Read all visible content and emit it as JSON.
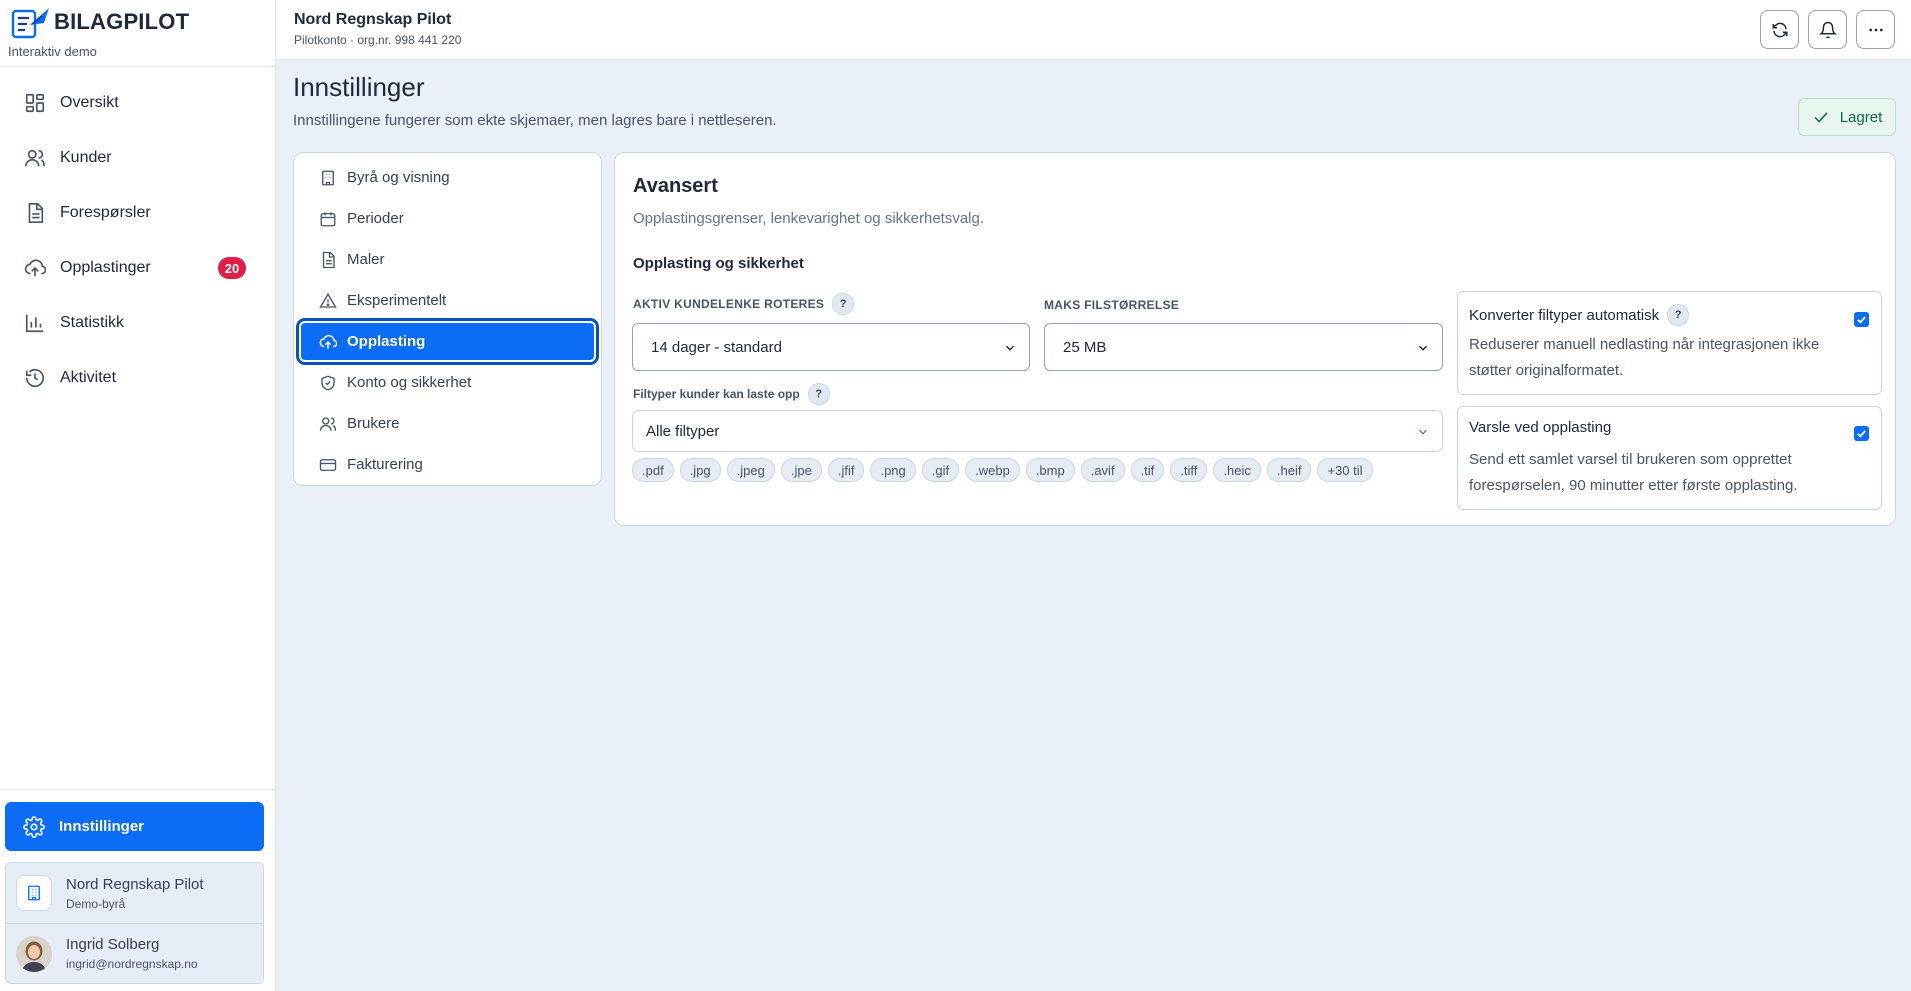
{
  "brand": {
    "name": "BILAGPILOT",
    "subtitle": "Interaktiv demo"
  },
  "nav": {
    "items": [
      {
        "label": "Oversikt",
        "icon": "dashboard-icon"
      },
      {
        "label": "Kunder",
        "icon": "users-icon"
      },
      {
        "label": "Forespørsler",
        "icon": "document-icon"
      },
      {
        "label": "Opplastinger",
        "icon": "upload-icon",
        "badge": "20"
      },
      {
        "label": "Statistikk",
        "icon": "bar-chart-icon"
      },
      {
        "label": "Aktivitet",
        "icon": "history-icon"
      }
    ]
  },
  "sidebar_bottom": {
    "settings_label": "Innstillinger",
    "org": {
      "name": "Nord Regnskap Pilot",
      "sub": "Demo-byrå"
    },
    "user": {
      "name": "Ingrid Solberg",
      "email": "ingrid@nordregnskap.no"
    }
  },
  "header": {
    "org_title": "Nord Regnskap Pilot",
    "org_sub": "Pilotkonto · org.nr. 998 441 220"
  },
  "page": {
    "title": "Innstillinger",
    "subtitle": "Innstillingene fungerer som ekte skjemaer, men lagres bare i nettleseren.",
    "saved_label": "Lagret"
  },
  "settings_menu": {
    "items": [
      {
        "label": "Byrå og visning",
        "icon": "building-icon"
      },
      {
        "label": "Perioder",
        "icon": "calendar-icon"
      },
      {
        "label": "Maler",
        "icon": "file-icon"
      },
      {
        "label": "Eksperimentelt",
        "icon": "warning-icon"
      },
      {
        "label": "Opplasting",
        "icon": "cloud-upload-icon",
        "active": true
      },
      {
        "label": "Konto og sikkerhet",
        "icon": "shield-icon"
      },
      {
        "label": "Brukere",
        "icon": "users-icon"
      },
      {
        "label": "Fakturering",
        "icon": "credit-card-icon"
      }
    ]
  },
  "panel": {
    "title": "Avansert",
    "subtitle": "Opplastingsgrenser, lenkevarighet og sikkerhetsvalg.",
    "section_title": "Opplasting og sikkerhet",
    "link_rotation": {
      "label": "AKTIV KUNDELENKE ROTERES",
      "value": "14 dager - standard"
    },
    "max_size": {
      "label": "MAKS FILSTØRRELSE",
      "value": "25 MB"
    },
    "file_types": {
      "label": "Filtyper kunder kan laste opp",
      "value": "Alle filtyper",
      "chips": [
        ".pdf",
        ".jpg",
        ".jpeg",
        ".jpe",
        ".jfif",
        ".png",
        ".gif",
        ".webp",
        ".bmp",
        ".avif",
        ".tif",
        ".tiff",
        ".heic",
        ".heif",
        "+30 til"
      ]
    },
    "convert": {
      "title": "Konverter filtyper automatisk",
      "description": "Reduserer manuell nedlasting når integrasjonen ikke støtter originalformatet.",
      "checked": true
    },
    "notify": {
      "title": "Varsle ved opplasting",
      "description": "Send ett samlet varsel til brukeren som opprettet forespørselen, 90 minutter etter første opplasting.",
      "checked": true
    },
    "help_symbol": "?"
  },
  "colors": {
    "accent": "#0b6cf5",
    "badge": "#e11d48",
    "saved": "#0f6a44"
  }
}
